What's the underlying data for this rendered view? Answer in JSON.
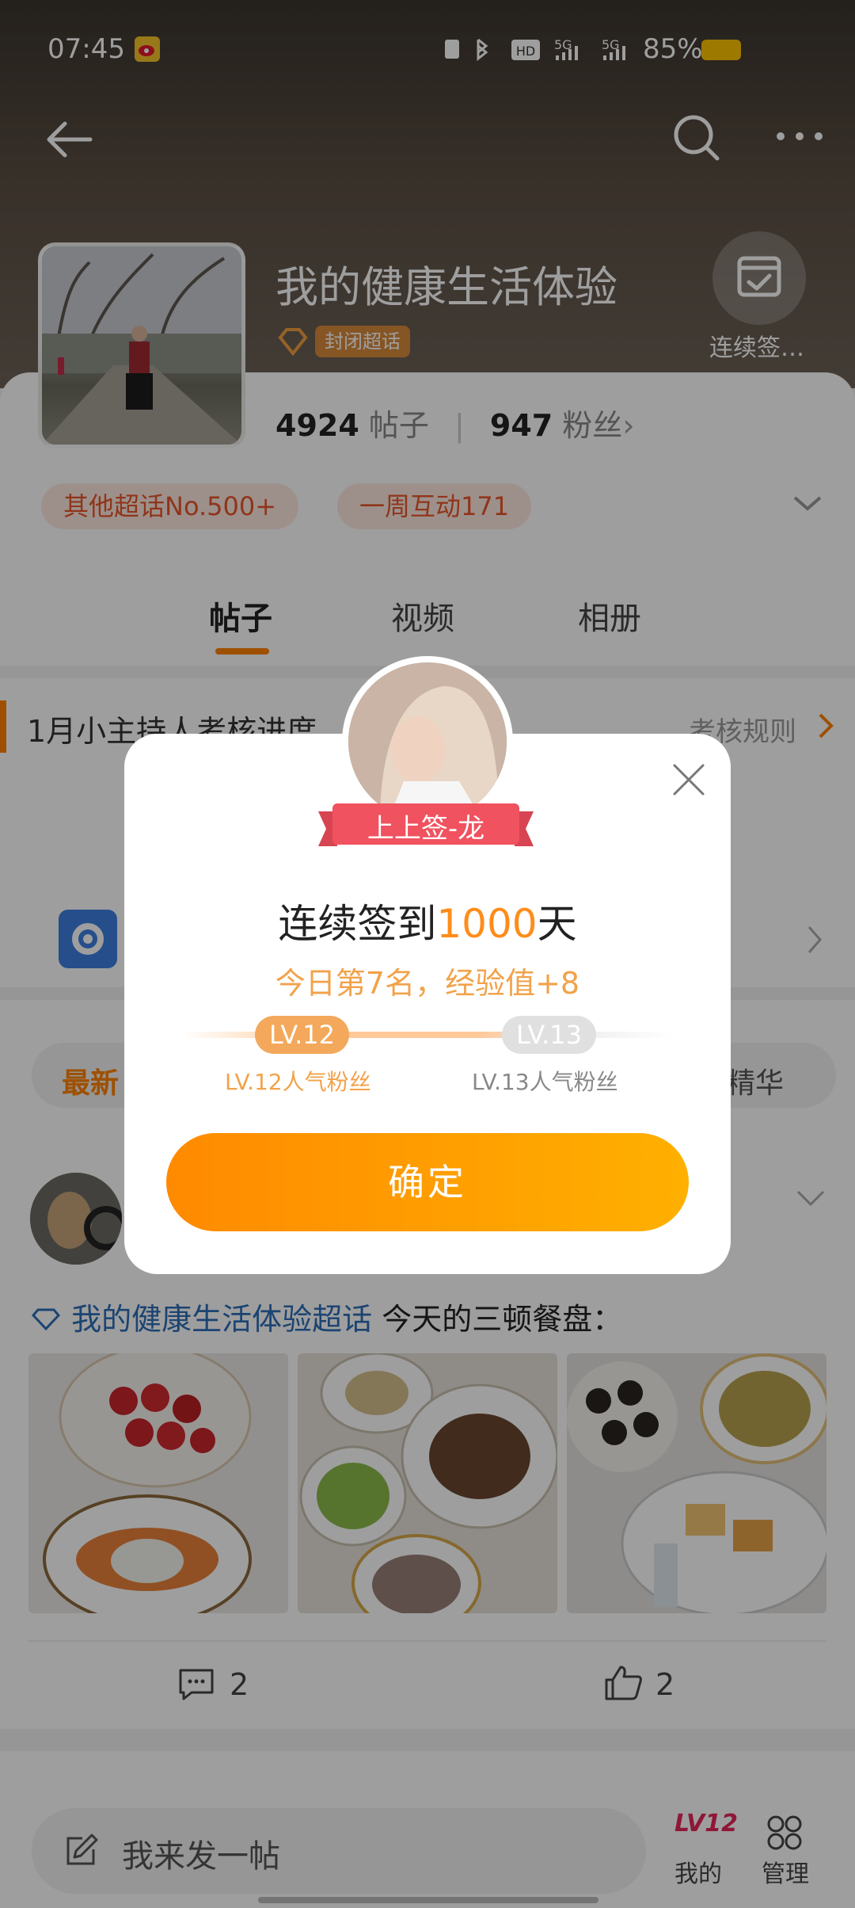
{
  "status": {
    "time": "07:45",
    "battery": "85%"
  },
  "topic": {
    "title": "我的健康生活体验",
    "closed_badge": "封闭超话",
    "checkin_label": "连续签…",
    "posts_count": "4924",
    "posts_label": "帖子",
    "fans_count": "947",
    "fans_label": "粉丝"
  },
  "tags": [
    "其他超话No.500+",
    "一周互动171"
  ],
  "tabs": [
    "帖子",
    "视频",
    "相册"
  ],
  "host": {
    "title": "1月小主持人考核进度",
    "rules_link": "考核规则"
  },
  "filters": {
    "latest": "最新",
    "essence": "精华"
  },
  "post": {
    "topic_link": "我的健康生活体验超话",
    "text": "今天的三顿餐盘：",
    "comments": "2",
    "likes": "2"
  },
  "dialog": {
    "ribbon": "上上签-龙",
    "title_prefix": "连续签到",
    "title_number": "1000",
    "title_suffix": "天",
    "subtitle": "今日第7名，经验值+8",
    "level_current": "LV.12",
    "level_current_label": "LV.12人气粉丝",
    "level_next": "LV.13",
    "level_next_label": "LV.13人气粉丝",
    "confirm": "确定"
  },
  "bottom": {
    "compose_placeholder": "我来发一帖",
    "my_level": "LV12",
    "my_label": "我的",
    "manage_label": "管理"
  },
  "colors": {
    "accent_orange": "#ff8c1a",
    "tag_text": "#e8562a",
    "topic_link": "#2d6fb8"
  }
}
